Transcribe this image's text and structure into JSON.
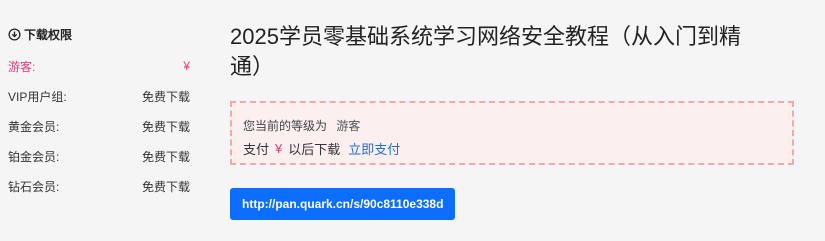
{
  "permissions": {
    "header": "下载权限",
    "icon": "download-circle-icon",
    "rows": [
      {
        "label": "游客:",
        "value": "¥"
      },
      {
        "label": "VIP用户组:",
        "value": "免费下载"
      },
      {
        "label": "黄金会员:",
        "value": "免费下载"
      },
      {
        "label": "铂金会员:",
        "value": "免费下载"
      },
      {
        "label": "钻石会员:",
        "value": "免费下载"
      }
    ]
  },
  "main": {
    "title": "2025学员零基础系统学习网络安全教程（从入门到精通）",
    "level_prefix": "您当前的等级为",
    "level_value": "游客",
    "pay_prefix": "支付",
    "pay_currency": "¥",
    "pay_suffix": "以后下载",
    "pay_link": "立即支付",
    "download_url": "http://pan.quark.cn/s/90c8110e338d"
  },
  "colors": {
    "accent": "#0d6efd",
    "guest": "#e0407a",
    "link": "#1f6fd1",
    "notice_border": "#f2a9a9",
    "notice_bg": "#fbefef"
  }
}
